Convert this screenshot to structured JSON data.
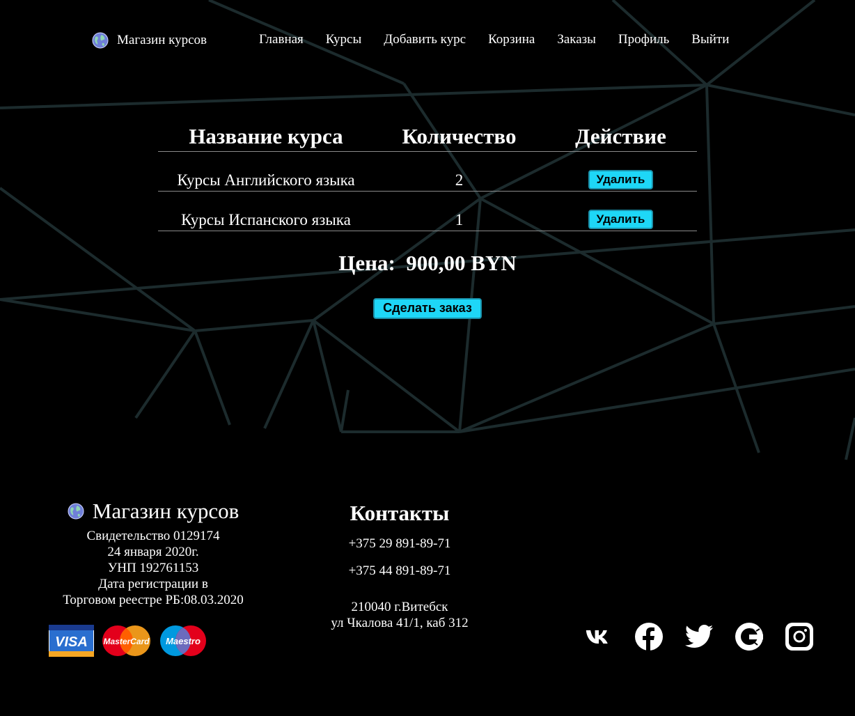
{
  "header": {
    "brand": "Магазин курсов",
    "nav": [
      {
        "label": "Главная"
      },
      {
        "label": "Курсы"
      },
      {
        "label": "Добавить курс"
      },
      {
        "label": "Корзина"
      },
      {
        "label": "Заказы"
      },
      {
        "label": "Профиль"
      },
      {
        "label": "Выйти"
      }
    ]
  },
  "cart": {
    "columns": [
      "Название курса",
      "Количество",
      "Действие"
    ],
    "rows": [
      {
        "name": "Курсы Английского языка",
        "qty": "2",
        "action": "Удалить"
      },
      {
        "name": "Курсы Испанского языка",
        "qty": "1",
        "action": "Удалить"
      }
    ],
    "price_label": "Цена:",
    "price_value": "900,00 BYN",
    "order_button": "Сделать заказ"
  },
  "footer": {
    "brand": "Магазин курсов",
    "lines": [
      "Свидетельство 0129174",
      "24 января 2020г.",
      "УНП 192761153",
      "Дата регистрации в",
      "Торговом реестре РБ:08.03.2020"
    ],
    "cards": [
      {
        "icon": "visa-card-icon",
        "label": "VISA"
      },
      {
        "icon": "mastercard-icon",
        "label": "MasterCard"
      },
      {
        "icon": "maestro-icon",
        "label": "Maestro"
      }
    ],
    "contacts_title": "Контакты",
    "phones": [
      "+375 29 891-89-71",
      "+375 44 891-89-71"
    ],
    "address_line1": "210040 г.Витебск",
    "address_line2": "ул Чкалова 41/1, каб 312",
    "social": [
      "vk-icon",
      "facebook-icon",
      "twitter-icon",
      "google-icon",
      "instagram-icon"
    ]
  },
  "colors": {
    "background": "#000000",
    "accent_button": "#1ed7f7",
    "network_lines": "#1c2b2d"
  }
}
